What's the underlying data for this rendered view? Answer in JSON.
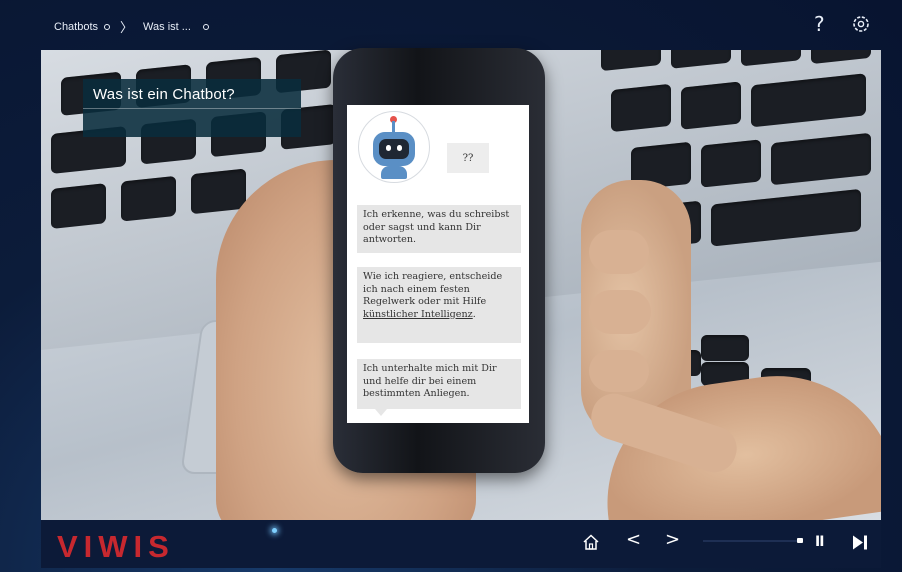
{
  "breadcrumb": {
    "items": [
      "Chatbots",
      "Was ist ..."
    ]
  },
  "header": {
    "help_label": "?"
  },
  "slide": {
    "title": "Was ist ein Chatbot?",
    "chat": {
      "question": "??",
      "bubble1": "Ich erkenne, was du schreibst oder sagst und kann Dir antworten.",
      "bubble2_prefix": "Wie ich reagiere, entscheide ich nach einem festen Regelwerk oder mit Hilfe ",
      "bubble2_link": "künstlicher Intelligenz",
      "bubble2_suffix": ".",
      "bubble3": "Ich unterhalte mich mit Dir und helfe dir bei einem bestimmten Anliegen."
    }
  },
  "footer": {
    "logo": "VIWIS",
    "home_icon": "home-icon",
    "prev_label": "<",
    "next_label": ">",
    "pause_label": "II",
    "progress": 0.93
  },
  "colors": {
    "logo": "#c7282f",
    "title_bg": "#092c3c",
    "bar_bg": "#0c1a38"
  }
}
